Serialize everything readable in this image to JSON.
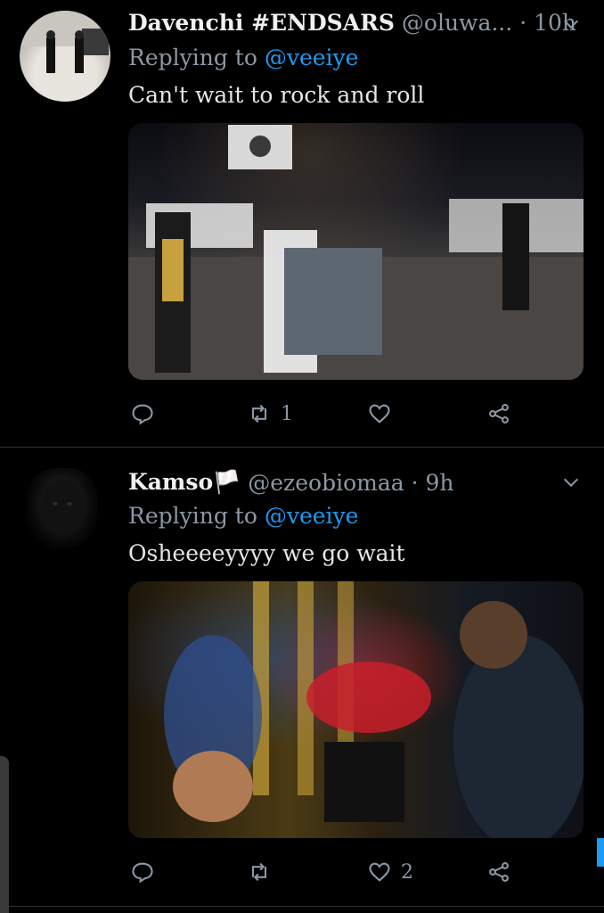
{
  "tweets": [
    {
      "name": "Davenchi #ENDSARS",
      "handle": "@oluwa...",
      "time": "· 10h",
      "replying_prefix": "Replying to",
      "replying_to": "@veeiye",
      "text": "Can't wait to rock and roll",
      "counts": {
        "reply": "",
        "retweet": "1",
        "like": ""
      }
    },
    {
      "name": "Kamso🏳️",
      "handle": "@ezeobiomaa · 9h",
      "time": "",
      "replying_prefix": "Replying to",
      "replying_to": "@veeiye",
      "text": "Osheeeeyyyy we go wait",
      "counts": {
        "reply": "",
        "retweet": "",
        "like": "2"
      }
    }
  ],
  "icons": [
    "chevron-down-icon",
    "reply-icon",
    "retweet-icon",
    "like-icon",
    "share-icon"
  ],
  "colors": {
    "background": "#000000",
    "accent": "#1d9bf0",
    "muted": "#8b98a5",
    "divider": "#2f3336"
  }
}
